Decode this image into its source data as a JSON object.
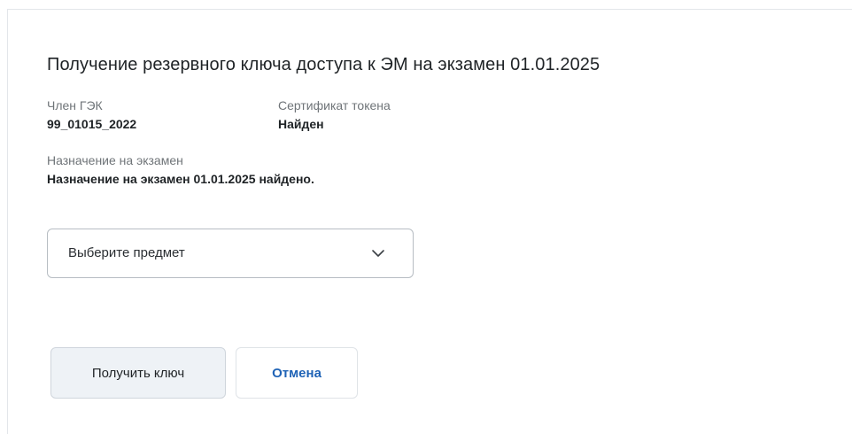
{
  "dialog": {
    "title": "Получение резервного ключа доступа к ЭМ на экзамен 01.01.2025",
    "member": {
      "label": "Член ГЭК",
      "value": "99_01015_2022"
    },
    "certificate": {
      "label": "Сертификат токена",
      "value": "Найден"
    },
    "assignment": {
      "label": "Назначение на экзамен",
      "value": "Назначение на экзамен 01.01.2025 найдено."
    },
    "subject_select": {
      "placeholder": "Выберите предмет",
      "icon": "chevron-down-icon"
    },
    "buttons": {
      "get_key": "Получить ключ",
      "cancel": "Отмена"
    }
  },
  "colors": {
    "accent": "#1f63b6",
    "primary_button_bg": "#eef2f6",
    "text_dark": "#1f2326",
    "text_muted": "#6f7478"
  }
}
